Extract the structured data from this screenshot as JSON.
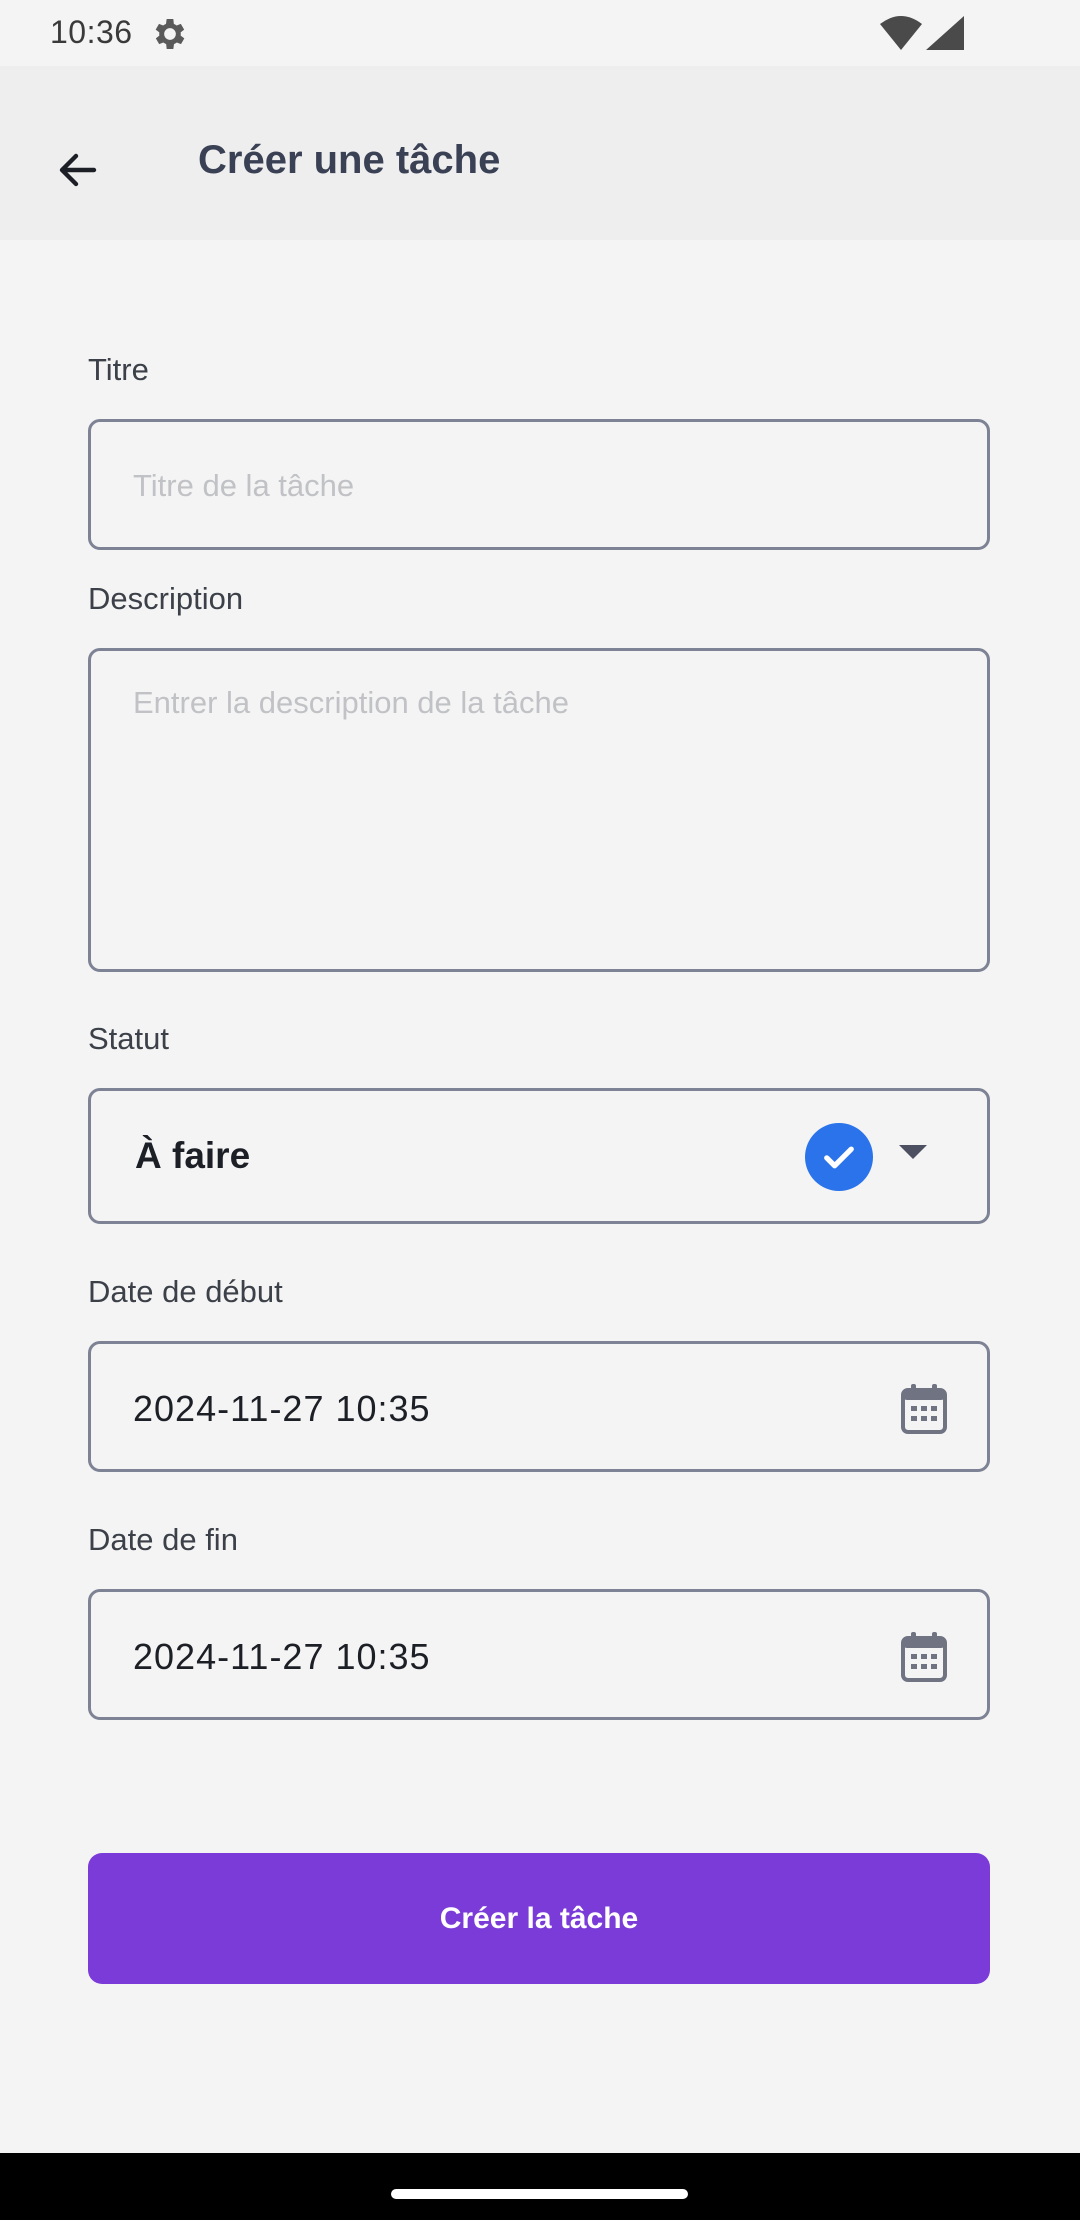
{
  "status_bar": {
    "time": "10:36",
    "icons": [
      "gear-icon",
      "wifi-icon",
      "cell-signal-icon"
    ]
  },
  "app_bar": {
    "title": "Créer une tâche",
    "back_icon": "arrow-back-icon"
  },
  "form": {
    "title_field": {
      "label": "Titre",
      "value": "",
      "placeholder": "Titre de la tâche"
    },
    "description_field": {
      "label": "Description",
      "value": "",
      "placeholder": "Entrer la description de la tâche"
    },
    "status_field": {
      "label": "Statut",
      "selected": "À faire",
      "icon": "check-circle-icon",
      "accent_color": "#2a73ea"
    },
    "start_date_field": {
      "label": "Date de début",
      "value": "2024-11-27 10:35",
      "icon": "calendar-icon"
    },
    "end_date_field": {
      "label": "Date de fin",
      "value": "2024-11-27 10:35",
      "icon": "calendar-icon"
    }
  },
  "submit": {
    "label": "Créer la tâche",
    "color": "#7b3bd8"
  }
}
